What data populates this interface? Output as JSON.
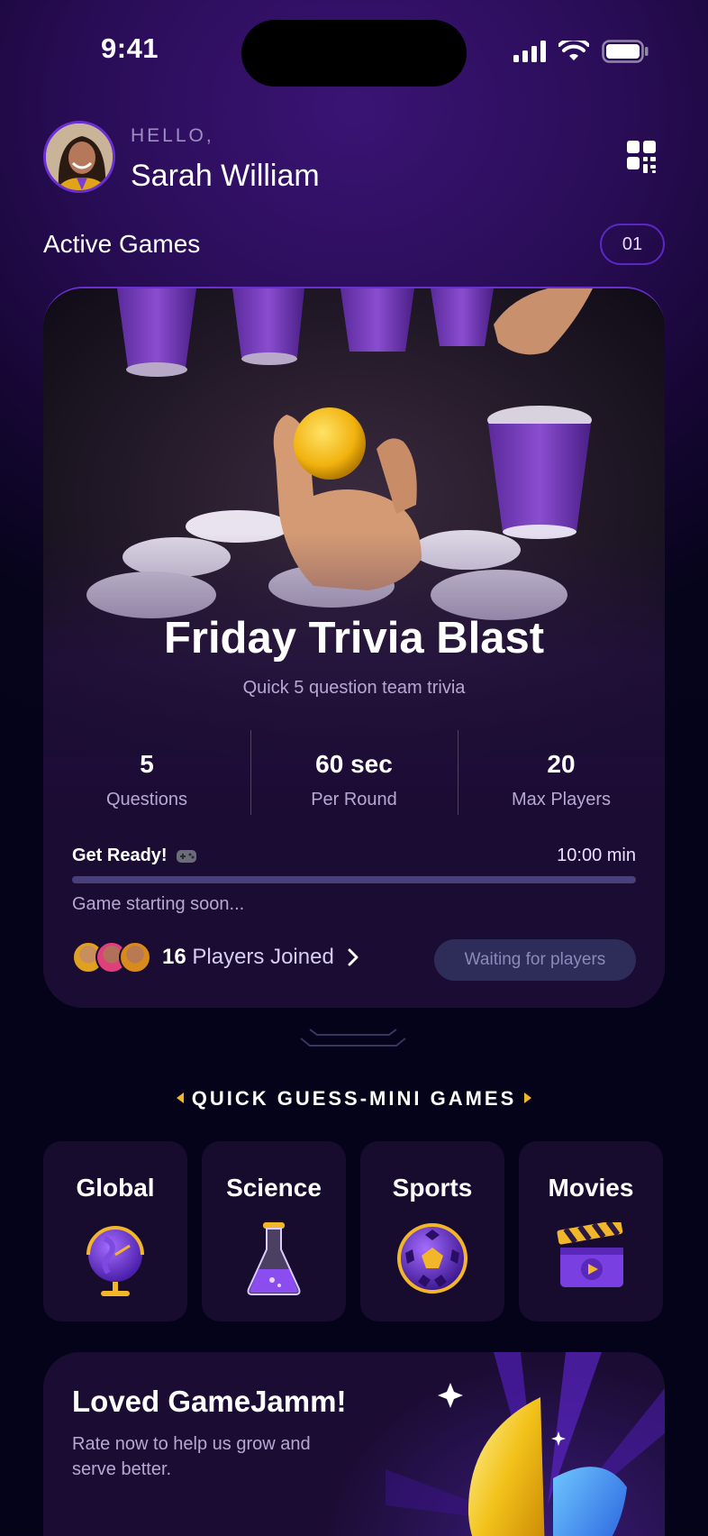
{
  "status_bar": {
    "time": "9:41"
  },
  "header": {
    "greeting": "HELLO,",
    "user_name": "Sarah William"
  },
  "active_games": {
    "title": "Active Games",
    "count": "01"
  },
  "game_card": {
    "title": "Friday Trivia Blast",
    "subtitle": "Quick 5 question team trivia",
    "stats": [
      {
        "value": "5",
        "label": "Questions"
      },
      {
        "value": "60 sec",
        "label": "Per Round"
      },
      {
        "value": "20",
        "label": "Max Players"
      }
    ],
    "ready_label": "Get Ready!",
    "timer": "10:00 min",
    "progress": 0,
    "status_text": "Game starting soon...",
    "players_count": "16",
    "players_label": "Players Joined",
    "waiting_button": "Waiting for players"
  },
  "mini_games": {
    "title": "QUICK GUESS-MINI GAMES",
    "tiles": [
      {
        "label": "Global",
        "icon": "globe-icon"
      },
      {
        "label": "Science",
        "icon": "flask-icon"
      },
      {
        "label": "Sports",
        "icon": "soccer-ball-icon"
      },
      {
        "label": "Movies",
        "icon": "clapperboard-icon"
      }
    ]
  },
  "rate_card": {
    "title": "Loved GameJamm!",
    "subtitle": "Rate now to help us grow and serve better."
  },
  "colors": {
    "accent": "#6a2fd0",
    "gold": "#f2b62b",
    "card_bg": "#1b0c33"
  }
}
